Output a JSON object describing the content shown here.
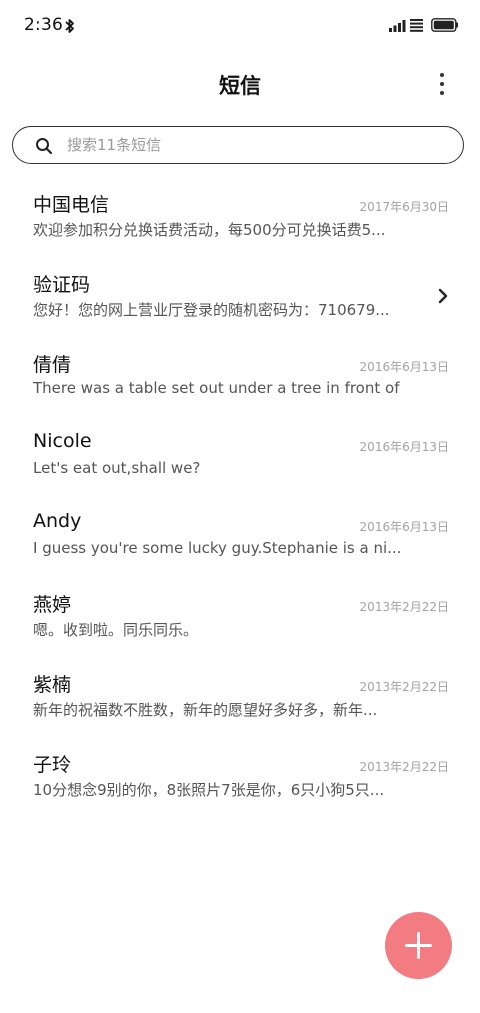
{
  "status_bar": {
    "time": "2:36",
    "icons": [
      "bluetooth-icon",
      "signal-icon",
      "data-icon",
      "battery-icon"
    ]
  },
  "header": {
    "title": "短信",
    "more_icon": "more-vertical-icon"
  },
  "search": {
    "placeholder": "搜索11条短信",
    "value": "",
    "icon": "search-icon"
  },
  "messages": [
    {
      "name": "中国电信",
      "date": "2017年6月30日",
      "preview": "欢迎参加积分兑换话费活动，每500分可兑换话费5..."
    },
    {
      "name": "验证码",
      "date": "",
      "preview": "您好！您的网上营业厅登录的随机密码为：710679...",
      "icon": "chevron-right-icon"
    },
    {
      "name": "倩倩",
      "date": "2016年6月13日",
      "preview": "There was a table set out under a tree in front of ..."
    },
    {
      "name": "Nicole",
      "date": "2016年6月13日",
      "preview": "Let's eat out,shall we?"
    },
    {
      "name": "Andy",
      "date": "2016年6月13日",
      "preview": "I guess you're some lucky guy.Stephanie is a ni..."
    },
    {
      "name": "燕婷",
      "date": "2013年2月22日",
      "preview": "嗯。收到啦。同乐同乐。"
    },
    {
      "name": "紫楠",
      "date": "2013年2月22日",
      "preview": "新年的祝福数不胜数，新年的愿望好多好多，新年..."
    },
    {
      "name": "子玲",
      "date": "2013年2月22日",
      "preview": "10分想念9别的你，8张照片7张是你，6只小狗5只..."
    }
  ],
  "compose": {
    "icon": "plus-icon",
    "color": "#f37c82"
  }
}
